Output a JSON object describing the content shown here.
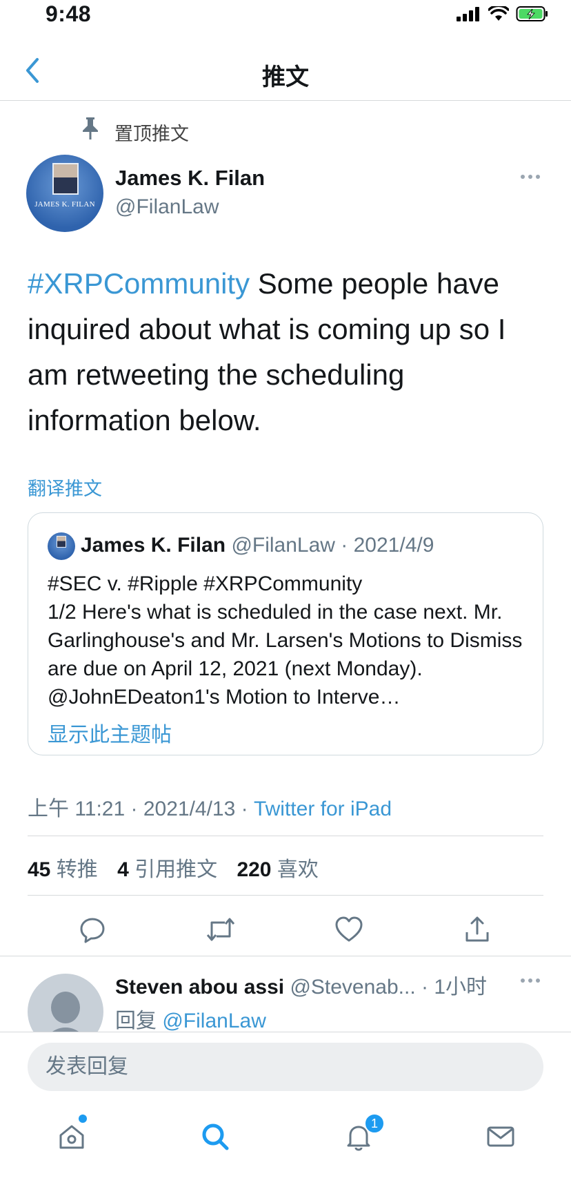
{
  "status_bar": {
    "time": "9:48"
  },
  "header": {
    "title": "推文"
  },
  "pinned": {
    "label": "置顶推文"
  },
  "tweet": {
    "author_name": "James K. Filan",
    "author_handle": "@FilanLaw",
    "avatar_caption": "JAMES K. FILAN",
    "hashtag": "#XRPCommunity",
    "text": " Some people have inquired about what is coming up so I am retweeting the scheduling information below.",
    "translate_label": "翻译推文",
    "quote": {
      "author_name": "James K. Filan",
      "author_handle": "@FilanLaw",
      "date": "· 2021/4/9",
      "text": "#SEC v. #Ripple #XRPCommunity\n1/2 Here's what is scheduled in the case next. Mr. Garlinghouse's and Mr. Larsen's Motions to Dismiss are due on April 12, 2021 (next Monday).  @JohnEDeaton1's Motion to Interve…",
      "show_thread": "显示此主题帖"
    },
    "time": "上午 11:21 · 2021/4/13 · ",
    "source": "Twitter for iPad",
    "stats": {
      "retweets": "45",
      "retweets_label": "转推",
      "quotes": "4",
      "quotes_label": "引用推文",
      "likes": "220",
      "likes_label": "喜欢"
    }
  },
  "reply": {
    "author_name": "Steven abou assi",
    "author_handle": "@Stevenab...",
    "time": " · 1小时",
    "replying_prefix": "回复 ",
    "replying_to": "@FilanLaw"
  },
  "compose": {
    "placeholder": "发表回复"
  },
  "tabbar": {
    "notification_count": "1"
  },
  "colors": {
    "accent": "#3a97d4",
    "badge": "#1d9bf0",
    "text": "#14171a",
    "muted": "#657786"
  }
}
